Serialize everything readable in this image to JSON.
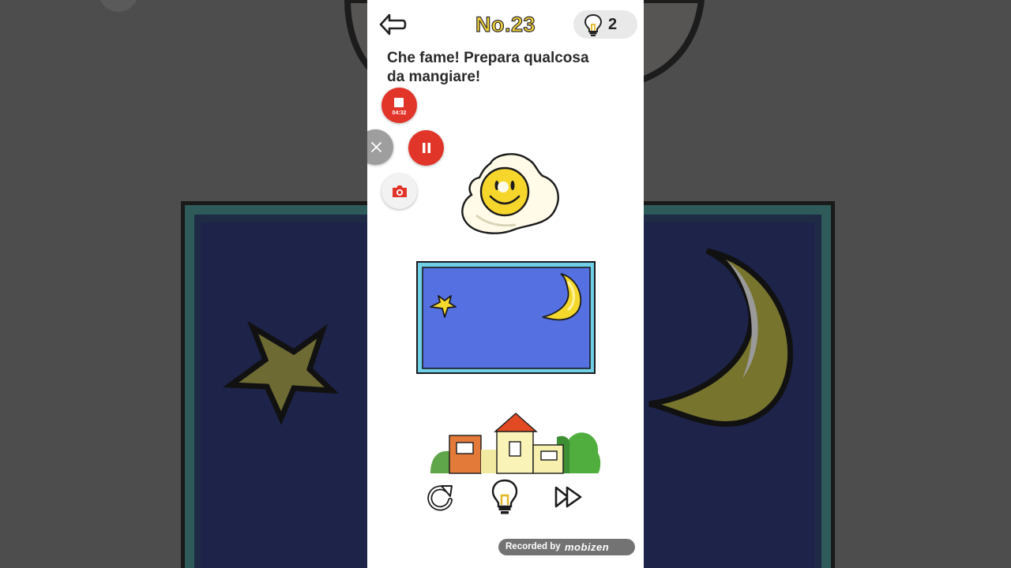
{
  "header": {
    "level_label": "No.23",
    "hint_count": "2"
  },
  "question": {
    "line1": "Che fame! Prepara qualcosa",
    "line2": "da mangiare!"
  },
  "recorder": {
    "timer": "04:32"
  },
  "watermark": {
    "prefix": "Recorded by",
    "brand": "mobizen"
  },
  "icons": [
    "back-arrow-icon",
    "lightbulb-icon",
    "stop-icon",
    "close-icon",
    "pause-icon",
    "camera-icon",
    "restart-icon",
    "hint-lightbulb-icon",
    "skip-icon"
  ],
  "colors": {
    "level_text": "#f3d23a",
    "record_red": "#e2352a",
    "sky_blue": "#5570e0",
    "frame_cyan": "#6fd0e6",
    "moon_yellow": "#f4d82c"
  }
}
